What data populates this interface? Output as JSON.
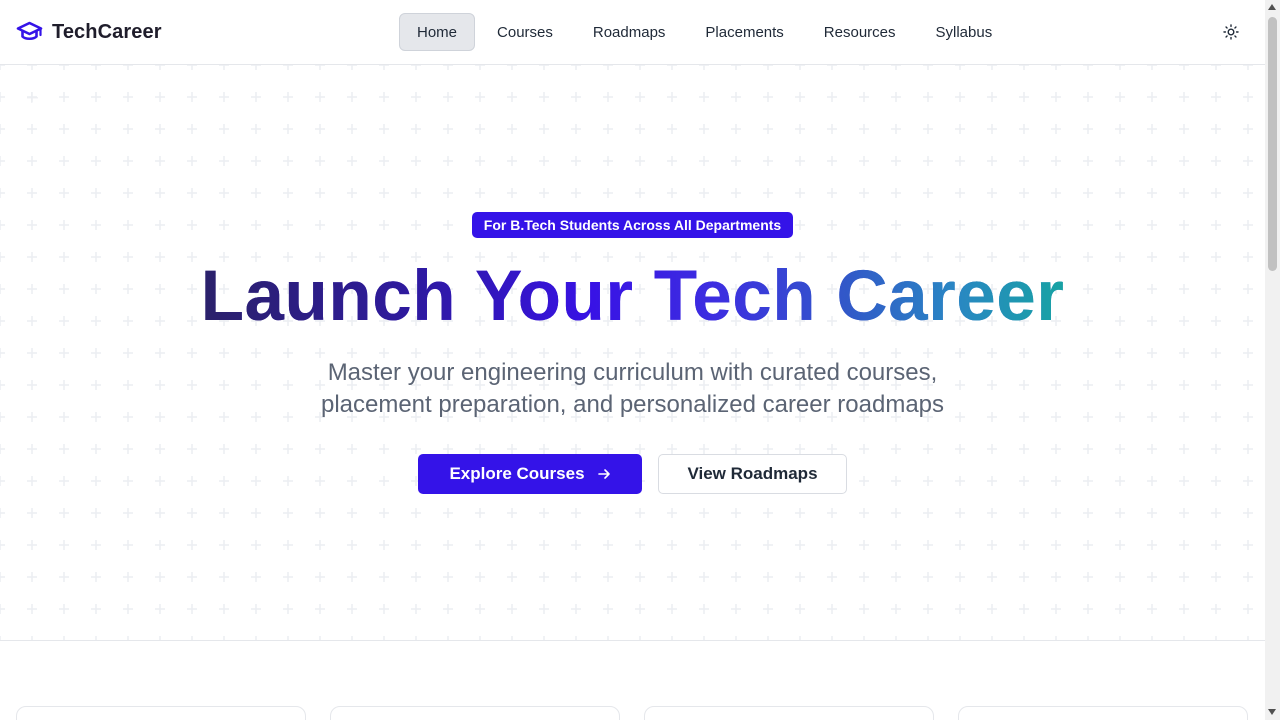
{
  "app": {
    "brand_name": "TechCareer",
    "brand_icon": "graduation-cap-icon",
    "accent_color": "#3413e8"
  },
  "nav": {
    "items": [
      {
        "label": "Home",
        "active": true
      },
      {
        "label": "Courses",
        "active": false
      },
      {
        "label": "Roadmaps",
        "active": false
      },
      {
        "label": "Placements",
        "active": false
      },
      {
        "label": "Resources",
        "active": false
      },
      {
        "label": "Syllabus",
        "active": false
      }
    ],
    "theme_toggle_icon": "sun-icon"
  },
  "hero": {
    "badge": "For B.Tech Students Across All Departments",
    "headline": "Launch Your Tech Career",
    "subtitle_line1": "Master your engineering curriculum with curated courses,",
    "subtitle_line2": "placement preparation, and personalized career roadmaps",
    "primary_cta": "Explore Courses",
    "primary_cta_icon": "arrow-right-icon",
    "secondary_cta": "View Roadmaps"
  }
}
